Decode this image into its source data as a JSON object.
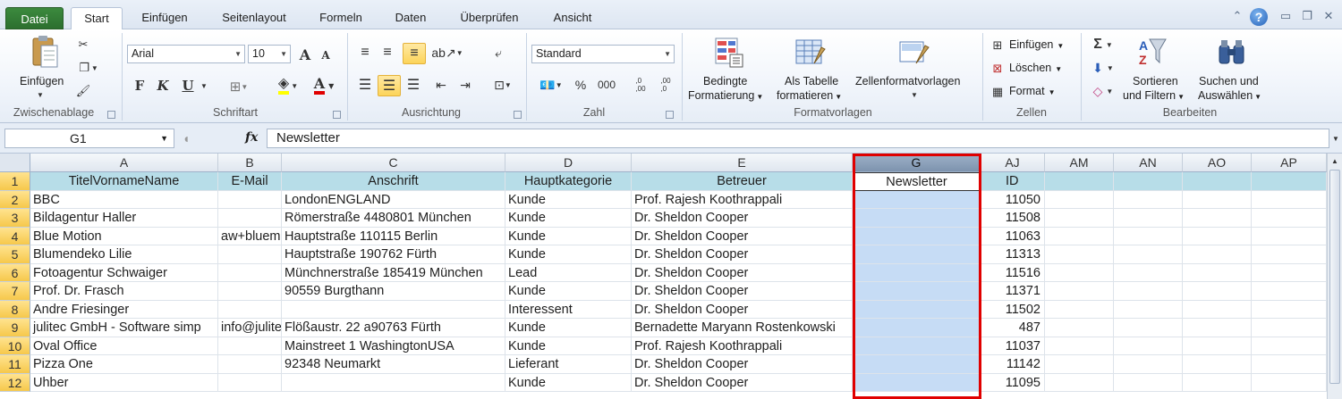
{
  "tabs": {
    "file": "Datei",
    "items": [
      "Start",
      "Einfügen",
      "Seitenlayout",
      "Formeln",
      "Daten",
      "Überprüfen",
      "Ansicht"
    ],
    "active": "Start",
    "help": "?"
  },
  "ribbon": {
    "clipboard": {
      "label": "Zwischenablage",
      "paste": "Einfügen"
    },
    "font": {
      "label": "Schriftart",
      "name": "Arial",
      "size": "10",
      "bold": "F",
      "italic": "K",
      "underline": "U",
      "grow": "A",
      "shrink": "A",
      "color": "A"
    },
    "alignment": {
      "label": "Ausrichtung"
    },
    "number": {
      "label": "Zahl",
      "format": "Standard",
      "percent": "%",
      "thousands": "000",
      "inc_dec": ",0\n,00",
      "dec_dec": ",00\n,0"
    },
    "styles": {
      "label": "Formatvorlagen",
      "cond_line1": "Bedingte",
      "cond_line2": "Formatierung",
      "table_line1": "Als Tabelle",
      "table_line2": "formatieren",
      "cell_styles": "Zellenformatvorlagen"
    },
    "cells": {
      "label": "Zellen",
      "insert": "Einfügen",
      "delete": "Löschen",
      "format": "Format"
    },
    "editing": {
      "label": "Bearbeiten",
      "sum": "Σ",
      "sort_line1": "Sortieren",
      "sort_line2": "und Filtern",
      "find_line1": "Suchen und",
      "find_line2": "Auswählen"
    }
  },
  "formula_bar": {
    "name_box": "G1",
    "fx": "fx",
    "content": "Newsletter"
  },
  "grid": {
    "columns": [
      "A",
      "B",
      "C",
      "D",
      "E",
      "G",
      "AJ",
      "AM",
      "AN",
      "AO",
      "AP"
    ],
    "selected_column": "G",
    "header_row": [
      "TitelVornameName",
      "E-Mail",
      "Anschrift",
      "Hauptkategorie",
      "Betreuer",
      "Newsletter",
      "ID",
      "",
      "",
      "",
      ""
    ],
    "rows": [
      {
        "n": "2",
        "a": "BBC",
        "b": "",
        "c": " LondonENGLAND",
        "d": "Kunde",
        "e": "Prof. Rajesh Koothrappali",
        "g": "",
        "id": "11050"
      },
      {
        "n": "3",
        "a": "Bildagentur Haller",
        "b": "",
        "c": "Römerstraße 4480801 München",
        "d": "Kunde",
        "e": "Dr. Sheldon Cooper",
        "g": "",
        "id": "11508"
      },
      {
        "n": "4",
        "a": "Blue Motion",
        "b": "aw+bluem",
        "c": "Hauptstraße 110115 Berlin",
        "d": "Kunde",
        "e": "Dr. Sheldon Cooper",
        "g": "",
        "id": "11063"
      },
      {
        "n": "5",
        "a": "Blumendeko Lilie",
        "b": "",
        "c": "Hauptstraße 190762 Fürth",
        "d": "Kunde",
        "e": "Dr. Sheldon Cooper",
        "g": "",
        "id": "11313"
      },
      {
        "n": "6",
        "a": "Fotoagentur Schwaiger",
        "b": "",
        "c": "Münchnerstraße 185419 München",
        "d": "Lead",
        "e": "Dr. Sheldon Cooper",
        "g": "",
        "id": "11516"
      },
      {
        "n": "7",
        "a": "Prof. Dr.  Frasch",
        "b": "",
        "c": "90559 Burgthann",
        "d": "Kunde",
        "e": "Dr. Sheldon Cooper",
        "g": "",
        "id": "11371"
      },
      {
        "n": "8",
        "a": "Andre Friesinger",
        "b": "",
        "c": "",
        "d": "Interessent",
        "e": "Dr. Sheldon Cooper",
        "g": "",
        "id": "11502"
      },
      {
        "n": "9",
        "a": "julitec GmbH - Software simp",
        "b": "info@julite",
        "c": "Flößaustr. 22 a90763 Fürth",
        "d": "Kunde",
        "e": "Bernadette Maryann Rostenkowski",
        "g": "",
        "id": "487"
      },
      {
        "n": "10",
        "a": "Oval Office",
        "b": "",
        "c": "Mainstreet 1 WashingtonUSA",
        "d": "Kunde",
        "e": "Prof. Rajesh Koothrappali",
        "g": "",
        "id": "11037"
      },
      {
        "n": "11",
        "a": "Pizza One",
        "b": "",
        "c": "92348 Neumarkt",
        "d": "Lieferant",
        "e": "Dr. Sheldon Cooper",
        "g": "",
        "id": "11142"
      },
      {
        "n": "12",
        "a": "Uhber",
        "b": "",
        "c": "",
        "d": "Kunde",
        "e": "Dr. Sheldon Cooper",
        "g": "",
        "id": "11095"
      }
    ],
    "header_row_number": "1",
    "accent_color": "#e00000",
    "header_fill": "#b7dde8",
    "selection_fill": "#c6dcf5"
  }
}
